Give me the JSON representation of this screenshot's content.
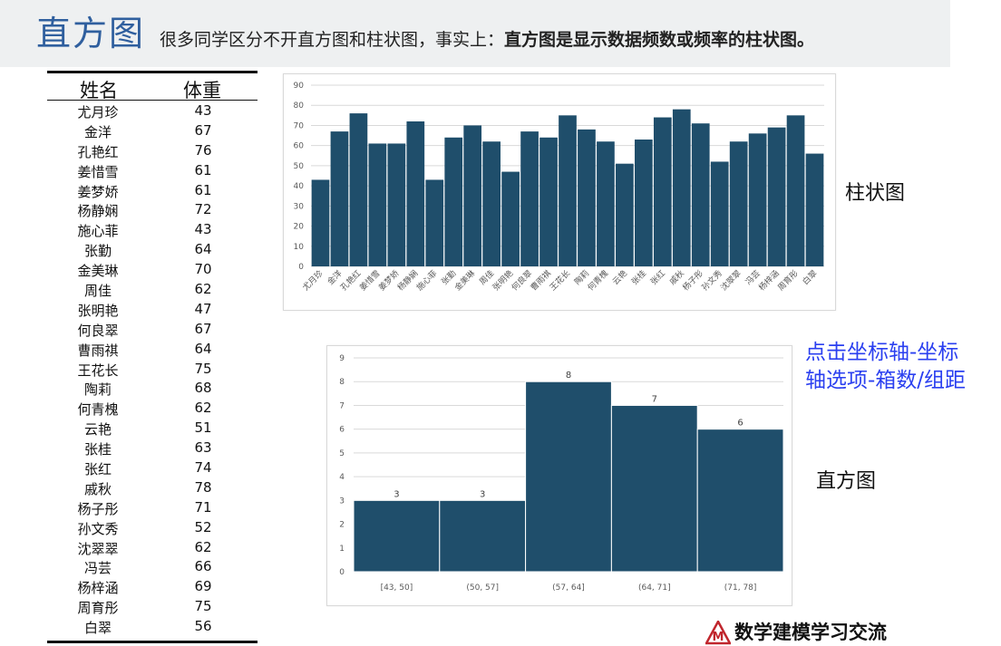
{
  "header": {
    "title": "直方图",
    "subtitle_plain": "很多同学区分不开直方图和柱状图，事实上：",
    "subtitle_bold": "直方图是显示数据频数或频率的柱状图。"
  },
  "table": {
    "col_name": "姓名",
    "col_weight": "体重",
    "rows": [
      {
        "name": "尤月珍",
        "weight": "43"
      },
      {
        "name": "金洋",
        "weight": "67"
      },
      {
        "name": "孔艳红",
        "weight": "76"
      },
      {
        "name": "姜惜雪",
        "weight": "61"
      },
      {
        "name": "姜梦娇",
        "weight": "61"
      },
      {
        "name": "杨静娴",
        "weight": "72"
      },
      {
        "name": "施心菲",
        "weight": "43"
      },
      {
        "name": "张勤",
        "weight": "64"
      },
      {
        "name": "金美琳",
        "weight": "70"
      },
      {
        "name": "周佳",
        "weight": "62"
      },
      {
        "name": "张明艳",
        "weight": "47"
      },
      {
        "name": "何良翠",
        "weight": "67"
      },
      {
        "name": "曹雨祺",
        "weight": "64"
      },
      {
        "name": "王花长",
        "weight": "75"
      },
      {
        "name": "陶莉",
        "weight": "68"
      },
      {
        "name": "何青槐",
        "weight": "62"
      },
      {
        "name": "云艳",
        "weight": "51"
      },
      {
        "name": "张桂",
        "weight": "63"
      },
      {
        "name": "张红",
        "weight": "74"
      },
      {
        "name": "戚秋",
        "weight": "78"
      },
      {
        "name": "杨子彤",
        "weight": "71"
      },
      {
        "name": "孙文秀",
        "weight": "52"
      },
      {
        "name": "沈翠翠",
        "weight": "62"
      },
      {
        "name": "冯芸",
        "weight": "66"
      },
      {
        "name": "杨梓涵",
        "weight": "69"
      },
      {
        "name": "周育彤",
        "weight": "75"
      },
      {
        "name": "白翠",
        "weight": "56"
      }
    ]
  },
  "labels": {
    "bar_chart": "柱状图",
    "histogram": "直方图",
    "hint_line1": "点击坐标轴-坐标",
    "hint_line2": "轴选项-箱数/组距",
    "footer": "数学建模学习交流",
    "logo_letter": "M"
  },
  "colors": {
    "bar": "#1f4e6b",
    "accent_blue": "#2a3ff0",
    "title_blue": "#2f5f9e",
    "logo_red": "#c0262d"
  },
  "chart_data": [
    {
      "type": "bar",
      "categories": [
        "尤月珍",
        "金洋",
        "孔艳红",
        "姜惜雪",
        "姜梦娇",
        "杨静娴",
        "施心菲",
        "张勤",
        "金美琳",
        "周佳",
        "张明艳",
        "何良翠",
        "曹雨祺",
        "王花长",
        "陶莉",
        "何青槐",
        "云艳",
        "张桂",
        "张红",
        "戚秋",
        "杨子彤",
        "孙文秀",
        "沈翠翠",
        "冯芸",
        "杨梓涵",
        "周育彤",
        "白翠"
      ],
      "values": [
        43,
        67,
        76,
        61,
        61,
        72,
        43,
        64,
        70,
        62,
        47,
        67,
        64,
        75,
        68,
        62,
        51,
        63,
        74,
        78,
        71,
        52,
        62,
        66,
        69,
        75,
        56
      ],
      "ylim": [
        0,
        90
      ],
      "yticks": [
        0,
        10,
        20,
        30,
        40,
        50,
        60,
        70,
        80,
        90
      ],
      "grid": true,
      "title": "",
      "xlabel": "",
      "ylabel": ""
    },
    {
      "type": "bar",
      "categories": [
        "[43, 50]",
        "(50, 57]",
        "(57, 64]",
        "(64, 71]",
        "(71, 78]"
      ],
      "values": [
        3,
        3,
        8,
        7,
        6
      ],
      "ylim": [
        0,
        9
      ],
      "yticks": [
        0,
        1,
        2,
        3,
        4,
        5,
        6,
        7,
        8,
        9
      ],
      "grid": true,
      "data_labels": true,
      "title": "",
      "xlabel": "",
      "ylabel": ""
    }
  ]
}
